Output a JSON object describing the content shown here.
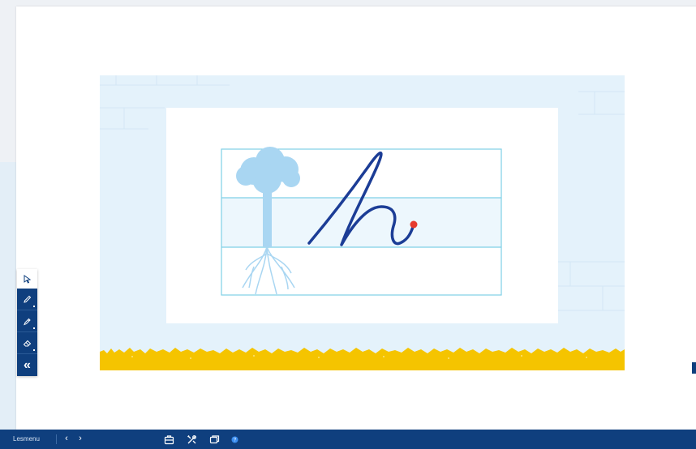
{
  "bottom_bar": {
    "menu_label": "Lesmenu",
    "prev_icon": "chevron-left-icon",
    "next_icon": "chevron-right-icon",
    "prev_glyph": "‹",
    "next_glyph": "›",
    "icons": [
      "briefcase-icon",
      "tools-icon",
      "windows-icon",
      "help-icon"
    ]
  },
  "toolbar": {
    "items": [
      "select-pointer-icon",
      "pen-icon",
      "marker-icon",
      "eraser-icon",
      "collapse-icon"
    ],
    "collapse_glyph": "«"
  },
  "slide": {
    "letter": "h",
    "colors": {
      "sky": "#e4f2fb",
      "ink": "#1c3d96",
      "start_dot": "#e63b2e",
      "grass": "#f5c400",
      "guide_lines": "#7fd0e6"
    }
  }
}
